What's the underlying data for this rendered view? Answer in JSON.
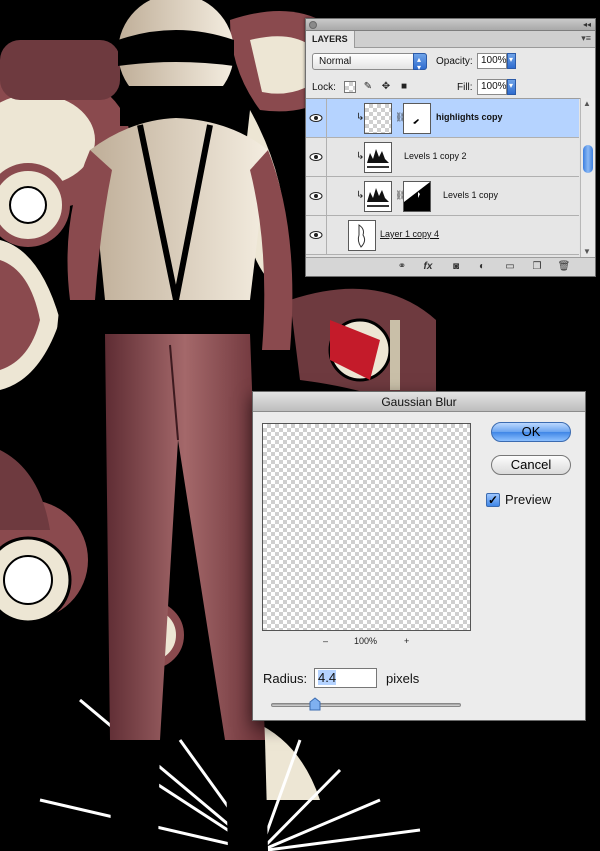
{
  "layers_panel": {
    "tab_label": "LAYERS",
    "blend_mode": "Normal",
    "opacity_label": "Opacity:",
    "opacity_value": "100%",
    "lock_label": "Lock:",
    "fill_label": "Fill:",
    "fill_value": "100%",
    "collapse_icon": "◂◂",
    "menu_icon": "▾≡",
    "layers": [
      {
        "name": "highlights copy",
        "selected": true,
        "visible": true,
        "clipped": true,
        "has_mask": true,
        "style": "bold"
      },
      {
        "name": "Levels 1 copy 2",
        "selected": false,
        "visible": true,
        "clipped": true,
        "has_mask": false,
        "style": "normal"
      },
      {
        "name": "Levels 1 copy",
        "selected": false,
        "visible": true,
        "clipped": true,
        "has_mask": true,
        "style": "normal"
      },
      {
        "name": "Layer 1 copy 4",
        "selected": false,
        "visible": true,
        "clipped": false,
        "has_mask": false,
        "style": "underline"
      }
    ],
    "footer_icons": [
      "link-icon",
      "fx-icon",
      "mask-icon",
      "adjustment-icon",
      "group-folder-icon",
      "new-layer-icon",
      "trash-icon"
    ]
  },
  "gaussian_blur": {
    "title": "Gaussian Blur",
    "ok_label": "OK",
    "cancel_label": "Cancel",
    "preview_label": "Preview",
    "preview_checked": true,
    "zoom_out_label": "–",
    "zoom_level": "100%",
    "zoom_in_label": "+",
    "radius_label": "Radius:",
    "radius_value": "4.4",
    "units_label": "pixels"
  },
  "colors": {
    "selection_blue": "#b5d3ff",
    "accent_blue": "#3f86e6",
    "art_suit": "#8a4a4e",
    "art_cream": "#ede6d4",
    "art_black": "#000000"
  }
}
